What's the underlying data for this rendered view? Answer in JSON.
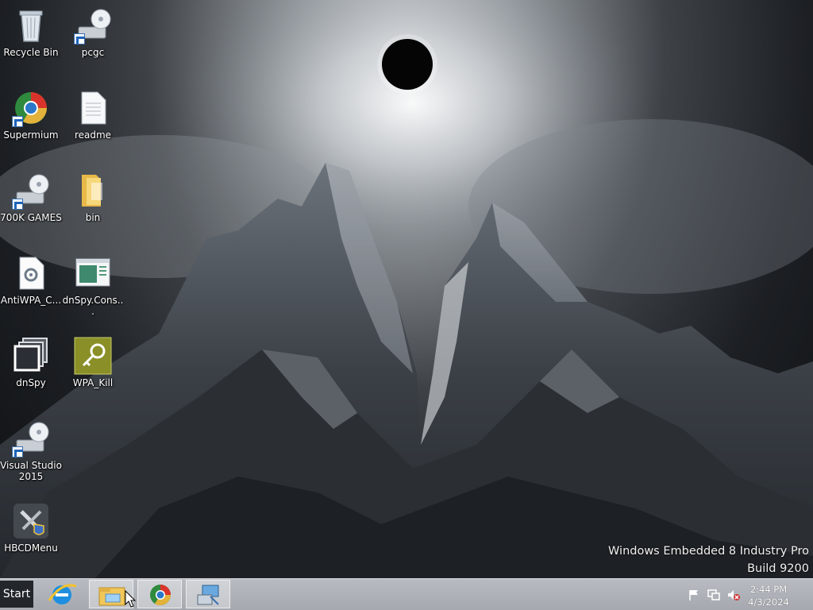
{
  "desktop": {
    "icons": [
      {
        "label": "Recycle Bin",
        "icon": "recycle-bin-icon"
      },
      {
        "label": "pcgc",
        "icon": "drive-shortcut-icon"
      },
      {
        "label": "Supermium",
        "icon": "browser-icon"
      },
      {
        "label": "readme",
        "icon": "text-file-icon"
      },
      {
        "label": "700K GAMES",
        "icon": "drive-shortcut-icon"
      },
      {
        "label": "bin",
        "icon": "folder-icon"
      },
      {
        "label": "AntiWPA_C...",
        "icon": "settings-file-icon"
      },
      {
        "label": "dnSpy.Cons...",
        "icon": "console-app-icon"
      },
      {
        "label": "dnSpy",
        "icon": "dnspy-icon"
      },
      {
        "label": "WPA_Kill",
        "icon": "key-icon"
      },
      {
        "label": "Visual Studio 2015",
        "icon": "drive-shortcut-icon"
      },
      {
        "label": "HBCDMenu",
        "icon": "tools-icon"
      }
    ],
    "watermark": {
      "line1": "Windows Embedded 8 Industry Pro",
      "line2": "Build 9200"
    }
  },
  "taskbar": {
    "start_label": "Start",
    "pinned": [
      {
        "name": "Internet Explorer",
        "icon": "ie-icon"
      },
      {
        "name": "File Explorer",
        "icon": "file-explorer-icon"
      },
      {
        "name": "Supermium",
        "icon": "browser-icon"
      },
      {
        "name": "Network Program",
        "icon": "network-computer-icon"
      }
    ],
    "tray": {
      "time": "2:44 PM",
      "date": "4/3/2024"
    }
  },
  "colors": {
    "taskbar": "#aeb2b8",
    "start_button": "#23272c",
    "ie_blue": "#1e8fe0",
    "folder_yellow": "#f1c75a"
  }
}
